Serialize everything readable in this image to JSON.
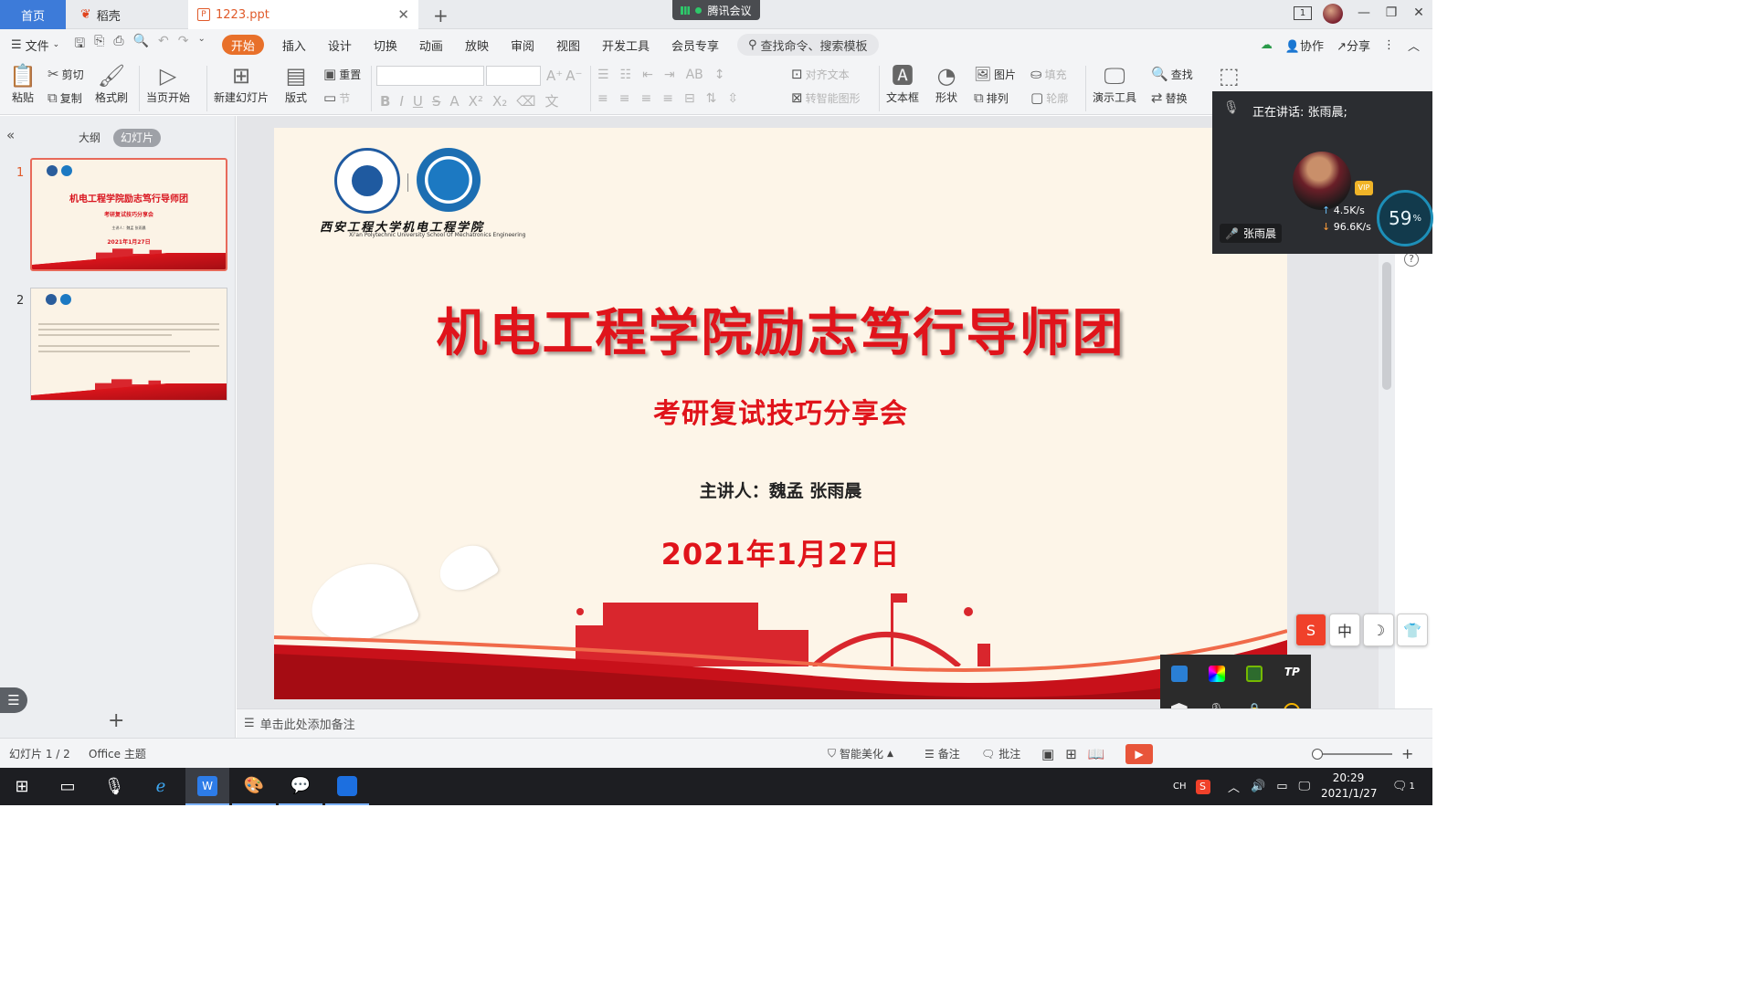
{
  "window": {
    "tabs": [
      {
        "label": "首页"
      },
      {
        "label": "稻壳"
      },
      {
        "label": "1223.ppt"
      }
    ],
    "meeting_label": "腾讯会议",
    "page_indicator": "1"
  },
  "menu": {
    "file": "文件",
    "items": [
      "开始",
      "插入",
      "设计",
      "切换",
      "动画",
      "放映",
      "审阅",
      "视图",
      "开发工具",
      "会员专享"
    ],
    "search_placeholder": "查找命令、搜索模板",
    "collab": "协作",
    "share": "分享"
  },
  "ribbon": {
    "paste": "粘贴",
    "cut": "剪切",
    "copy": "复制",
    "format_painter": "格式刷",
    "start_current": "当页开始",
    "new_slide": "新建幻灯片",
    "layout": "版式",
    "reset": "重置",
    "section": "节",
    "align_text": "对齐文本",
    "smart_shape": "转智能图形",
    "textbox": "文本框",
    "shape": "形状",
    "picture": "图片",
    "arrange": "排列",
    "fill": "填充",
    "outline": "轮廓",
    "present_tools": "演示工具",
    "find": "查找",
    "replace": "替换"
  },
  "left_pane": {
    "tab_outline": "大纲",
    "tab_slides": "幻灯片",
    "thumbnails": [
      {
        "num": "1",
        "title": "机电工程学院励志笃行导师团",
        "sub": "考研复试技巧分享会",
        "speaker": "主讲人：魏孟 张雨晨",
        "date": "2021年1月27日"
      },
      {
        "num": "2"
      }
    ]
  },
  "slide": {
    "school_name_cn": "西安工程大学机电工程学院",
    "school_name_en": "Xi'an Polytechnic University School Of Mechatronics Engineering",
    "title": "机电工程学院励志笃行导师团",
    "subtitle": "考研复试技巧分享会",
    "speaker": "主讲人：魏孟 张雨晨",
    "date": "2021年1月27日"
  },
  "meeting_panel": {
    "speaking": "正在讲话: 张雨晨;",
    "participant": "张雨晨",
    "vip": "VIP",
    "upload": "4.5K/s",
    "download": "96.6K/s",
    "gauge_value": "59",
    "gauge_unit": "%"
  },
  "ime": [
    "S",
    "中",
    "☽",
    "👕"
  ],
  "notes_placeholder": "单击此处添加备注",
  "status": {
    "slide_count": "幻灯片 1 / 2",
    "theme": "Office 主题",
    "beautify": "智能美化",
    "notes": "备注",
    "comment": "批注"
  },
  "taskbar": {
    "lang": "CH",
    "time": "20:29",
    "date": "2021/1/27",
    "notifications": "1"
  },
  "colors": {
    "accent_orange": "#e8702a",
    "slide_red": "#e0141b",
    "tab_blue": "#3d7bd9"
  }
}
